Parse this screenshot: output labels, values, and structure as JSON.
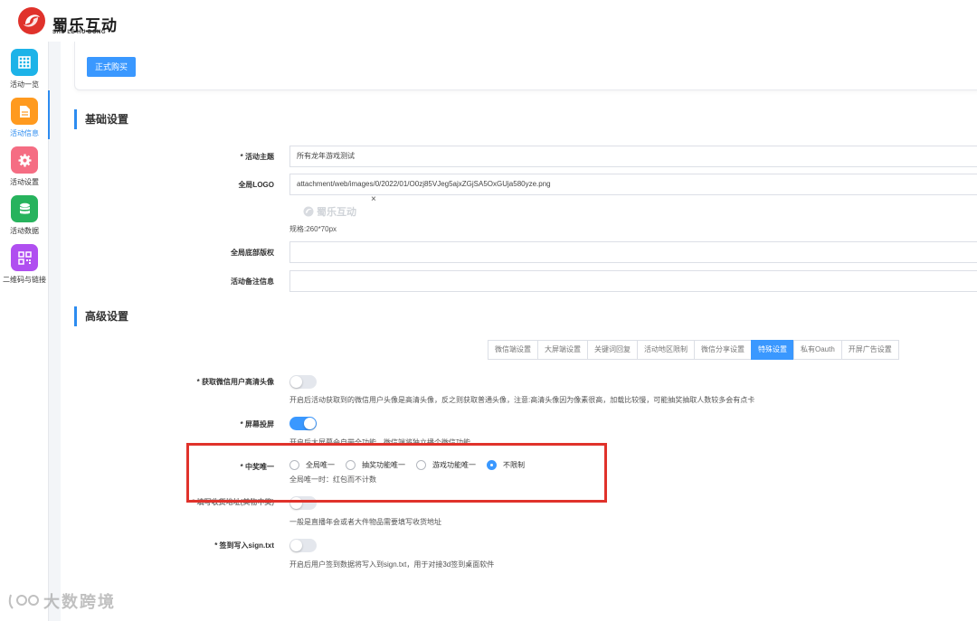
{
  "brand": {
    "name": "蜀乐互动",
    "sub": "SHU LE HU DONG",
    "color": "#e0322b"
  },
  "sidebar": {
    "items": [
      {
        "label": "活动一览",
        "icon": "grid-icon",
        "color": "#1db3e8"
      },
      {
        "label": "活动信息",
        "icon": "document-icon",
        "color": "#ff9a1f"
      },
      {
        "label": "活动设置",
        "icon": "gear-icon",
        "color": "#f56d83"
      },
      {
        "label": "活动数据",
        "icon": "database-icon",
        "color": "#27b35d"
      },
      {
        "label": "二维码与链接",
        "icon": "qrcode-icon",
        "color": "#b04ff0"
      }
    ]
  },
  "top_card": {
    "buy_button": "正式购买"
  },
  "basic_section": {
    "title": "基础设置",
    "fields": [
      {
        "label": "* 活动主题",
        "value": "所有龙年游戏测试"
      },
      {
        "label": "全局LOGO",
        "value": "attachment/web/images/0/2022/01/O0zj85VJeg5ajxZGjSA5OxGUja580yze.png"
      },
      {
        "label": "全局底部版权",
        "value": ""
      },
      {
        "label": "活动备注信息",
        "value": ""
      }
    ],
    "logo_preview": "蜀乐互动",
    "logo_remove": "×",
    "logo_size_hint": "规格:260*70px"
  },
  "advanced_section": {
    "title": "高级设置",
    "tabs": [
      {
        "label": "微信端设置",
        "active": false
      },
      {
        "label": "大屏端设置",
        "active": false
      },
      {
        "label": "关键词回复",
        "active": false
      },
      {
        "label": "活动地区限制",
        "active": false
      },
      {
        "label": "微信分享设置",
        "active": false
      },
      {
        "label": "特殊设置",
        "active": true
      },
      {
        "label": "私有Oauth",
        "active": false
      },
      {
        "label": "开屏广告设置",
        "active": false
      }
    ],
    "settings": [
      {
        "label": "* 获取微信用户高清头像",
        "on": false,
        "hint": "开启后活动获取到的微信用户头像是高清头像，反之则获取普通头像，注意:高清头像因为像素很高，加载比较慢，可能抽奖抽取人数较多会有点卡"
      },
      {
        "label": "* 屏幕投屏",
        "on": true,
        "hint": "开启后大屏幕会自带全功能，微信端将独立播个微信功能"
      },
      {
        "label": "* 中奖唯一",
        "options": [
          "全局唯一",
          "抽奖功能唯一",
          "游戏功能唯一",
          "不限制"
        ],
        "selected": 3,
        "hint": "全局唯一时：红包而不计数"
      },
      {
        "label": "* 填写收货地址(美物中奖)",
        "on": false,
        "hint": "一般是直播年会或者大件物品需要填写收货地址"
      },
      {
        "label": "* 签到写入sign.txt",
        "on": false,
        "hint": "开启后用户签到数据将写入到sign.txt，用于对接3d签到桌面软件"
      }
    ]
  },
  "watermark": "大数跨境"
}
